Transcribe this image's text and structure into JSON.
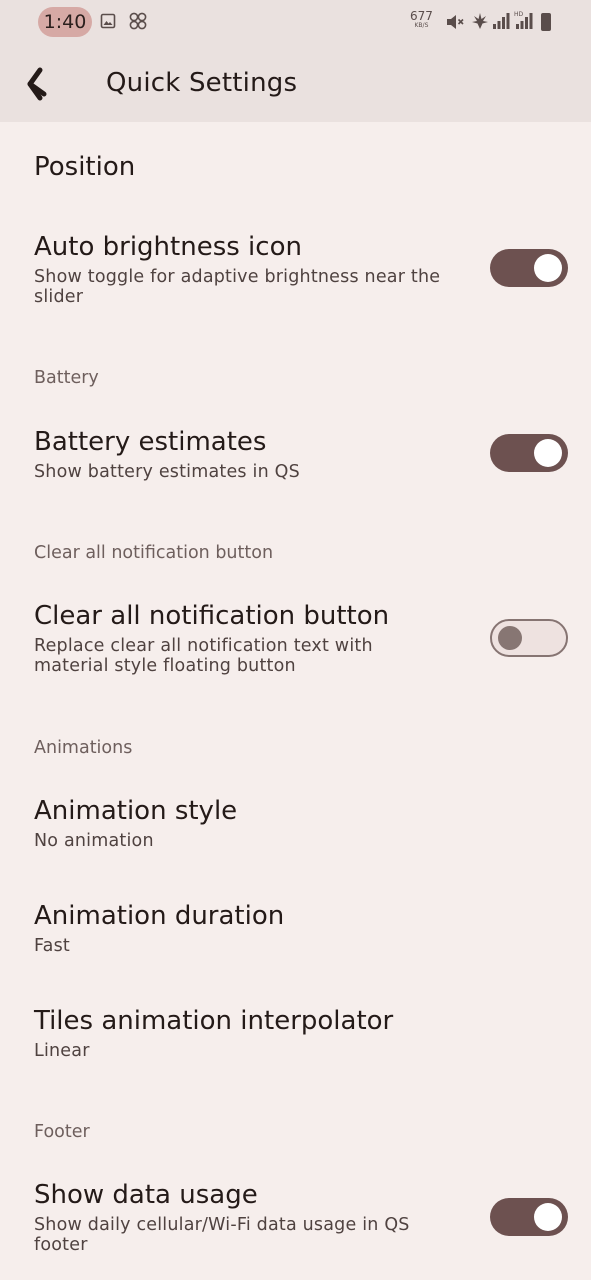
{
  "status_bar": {
    "time": "1:40",
    "net_speed_value": "677",
    "net_speed_unit": "KB/S",
    "icons": [
      "gallery-icon",
      "pinwheel-icon",
      "mute-icon",
      "vpn-leaf-icon",
      "signal-icon",
      "signal-hd-icon",
      "battery-icon"
    ]
  },
  "app_bar": {
    "title": "Quick Settings",
    "back_icon": "back-arrow-icon"
  },
  "colors": {
    "background": "#f6eeec",
    "bar": "#eae1df",
    "toggle_on": "#6d5150",
    "toggle_off_outline": "#867472"
  },
  "items": {
    "position": {
      "title": "Position"
    },
    "auto_brightness": {
      "title": "Auto brightness icon",
      "subtitle_line1": "Show toggle for adaptive brightness near the",
      "subtitle_line2": "slider",
      "enabled": true
    },
    "battery_header": "Battery",
    "battery_estimates": {
      "title": "Battery estimates",
      "subtitle": "Show battery estimates in QS",
      "enabled": true
    },
    "clear_all_header": "Clear all notification button",
    "clear_all": {
      "title": "Clear all notification button",
      "subtitle_line1": "Replace clear all notification text with",
      "subtitle_line2": "material style floating button",
      "enabled": false
    },
    "animations_header": "Animations",
    "animation_style": {
      "title": "Animation style",
      "value": "No animation"
    },
    "animation_duration": {
      "title": "Animation duration",
      "value": "Fast"
    },
    "tiles_interpolator": {
      "title": "Tiles animation interpolator",
      "value": "Linear"
    },
    "footer_header": "Footer",
    "show_data_usage": {
      "title": "Show data usage",
      "subtitle_line1": "Show daily cellular/Wi-Fi data usage in QS",
      "subtitle_line2": "footer",
      "enabled": true
    }
  }
}
